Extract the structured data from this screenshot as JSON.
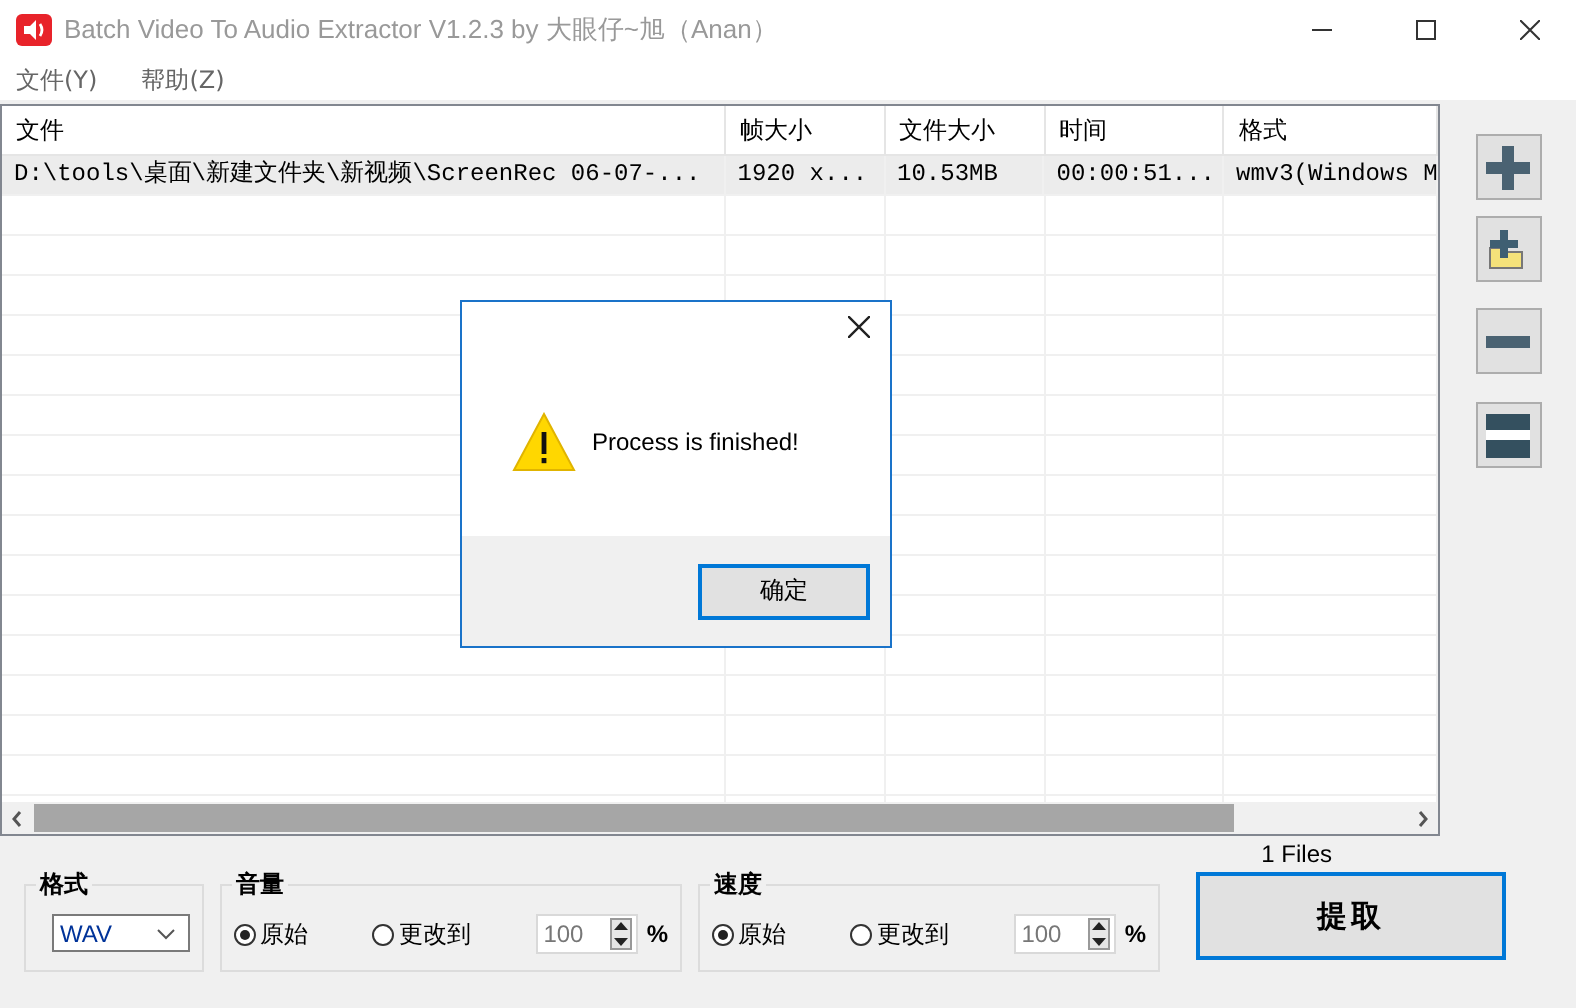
{
  "window": {
    "title": "Batch Video To Audio Extractor V1.2.3 by 大眼仔~旭（Anan）"
  },
  "menu": [
    {
      "label": "文件(Y)"
    },
    {
      "label": "帮助(Z)"
    }
  ],
  "table": {
    "columns": [
      "文件",
      "帧大小",
      "文件大小",
      "时间",
      "格式"
    ],
    "rows": [
      {
        "selected": true,
        "cells": [
          "D:\\tools\\桌面\\新建文件夹\\新视频\\ScreenRec 06-07-...",
          "1920 x...",
          "10.53MB",
          "00:00:51...",
          "wmv3(Windows M"
        ]
      }
    ]
  },
  "file_count": "1 Files",
  "format": {
    "label": "格式",
    "value": "WAV"
  },
  "volume": {
    "label": "音量",
    "options": [
      {
        "label": "原始",
        "selected": true
      },
      {
        "label": "更改到",
        "selected": false
      }
    ],
    "value": "100",
    "unit": "%"
  },
  "speed": {
    "label": "速度",
    "options": [
      {
        "label": "原始",
        "selected": true
      },
      {
        "label": "更改到",
        "selected": false
      }
    ],
    "value": "100",
    "unit": "%"
  },
  "extract_button": "提取",
  "dialog": {
    "message": "Process is finished!",
    "button": "确定"
  }
}
